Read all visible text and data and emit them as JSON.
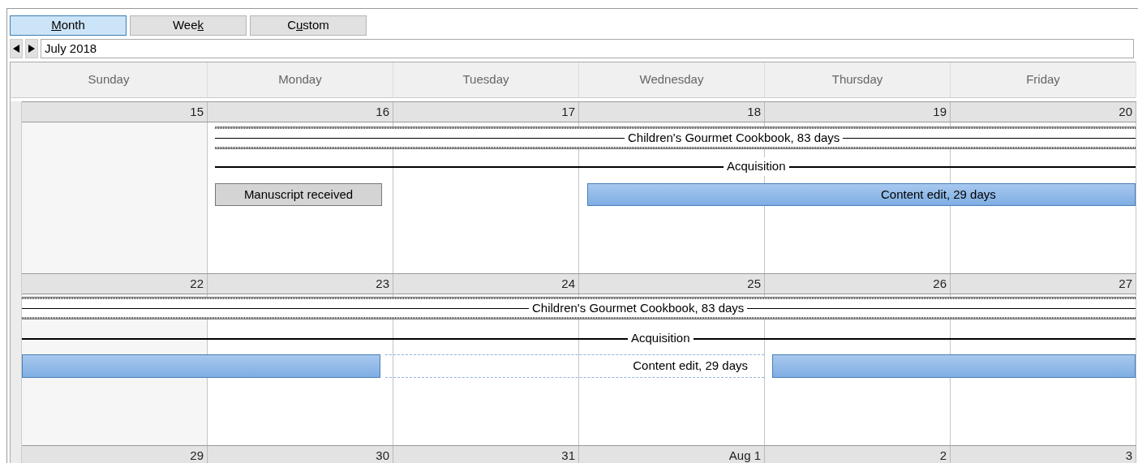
{
  "view_tabs": [
    {
      "access_key": "M",
      "label_rest": "onth",
      "selected": true
    },
    {
      "label_start": "Wee",
      "access_key": "k",
      "selected": false
    },
    {
      "label_start": "C",
      "access_key": "u",
      "label_rest": "stom",
      "selected": false
    }
  ],
  "period": "July 2018",
  "day_headers": [
    "Sunday",
    "Monday",
    "Tuesday",
    "Wednesday",
    "Thursday",
    "Friday"
  ],
  "weeks": [
    {
      "dates": [
        "15",
        "16",
        "17",
        "18",
        "19",
        "20"
      ],
      "bars": [
        {
          "kind": "project",
          "label": "Children's Gourmet Cookbook, 83 days"
        },
        {
          "kind": "phase",
          "label": "Acquisition"
        },
        {
          "kind": "milestone",
          "label": "Manuscript received"
        },
        {
          "kind": "task",
          "label": "Content edit, 29 days"
        }
      ]
    },
    {
      "dates": [
        "22",
        "23",
        "24",
        "25",
        "26",
        "27"
      ],
      "bars": [
        {
          "kind": "project",
          "label": "Children's Gourmet Cookbook, 83 days"
        },
        {
          "kind": "phase",
          "label": "Acquisition"
        },
        {
          "kind": "split-task",
          "label": "Content edit, 29 days"
        }
      ]
    },
    {
      "dates": [
        "29",
        "30",
        "31",
        "Aug 1",
        "2",
        "3"
      ]
    }
  ]
}
